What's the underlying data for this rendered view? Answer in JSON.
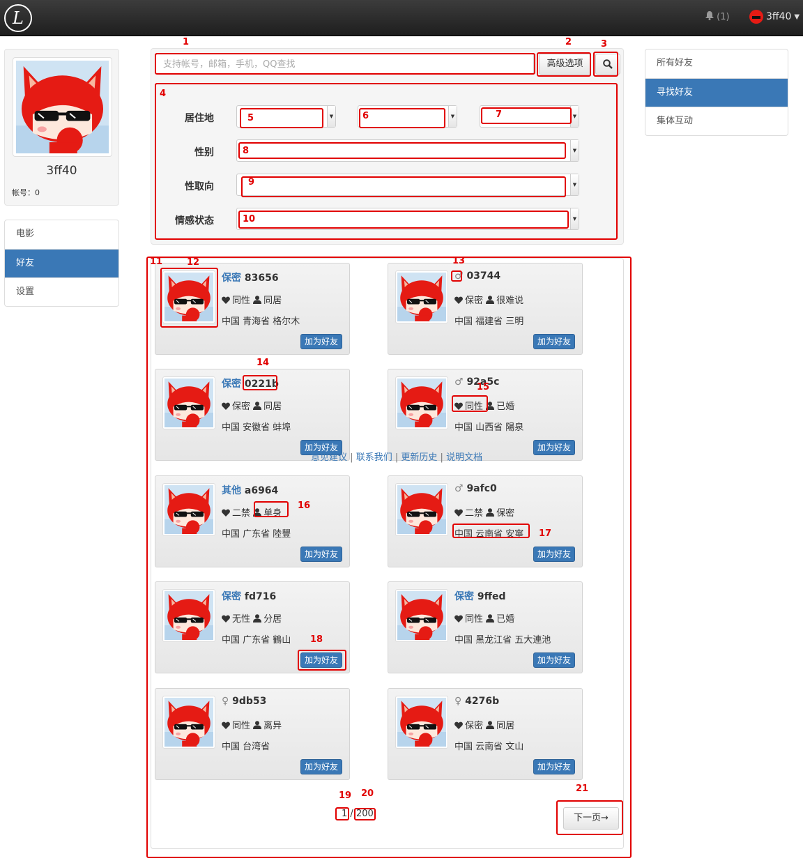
{
  "topbar": {
    "logo_letter": "L",
    "notifications_label": "(1)",
    "username": "3ff40"
  },
  "profile": {
    "name": "3ff40",
    "account_label": "帐号：0"
  },
  "leftnav": {
    "items": [
      {
        "label": "电影",
        "active": false
      },
      {
        "label": "好友",
        "active": true
      },
      {
        "label": "设置",
        "active": false
      }
    ]
  },
  "rightnav": {
    "items": [
      {
        "label": "所有好友",
        "active": false
      },
      {
        "label": "寻找好友",
        "active": true
      },
      {
        "label": "集体互动",
        "active": false
      }
    ]
  },
  "search": {
    "placeholder": "支持帐号，邮箱，手机，QQ查找",
    "advanced_label": "高级选项"
  },
  "filters": {
    "residence_label": "居住地",
    "gender_label": "性别",
    "orientation_label": "性取向",
    "relationship_label": "情感状态"
  },
  "results": [
    {
      "gender": "保密",
      "id": "83656",
      "orientation": "同性",
      "status": "同居",
      "location": "中国 青海省 格尔木"
    },
    {
      "gender": "♂",
      "id": "03744",
      "orientation": "保密",
      "status": "很难说",
      "location": "中国 福建省 三明"
    },
    {
      "gender": "保密",
      "id": "0221b",
      "orientation": "保密",
      "status": "同居",
      "location": "中国 安徽省 蚌埠"
    },
    {
      "gender": "♂",
      "id": "92a5c",
      "orientation": "同性",
      "status": "已婚",
      "location": "中国 山西省 陽泉"
    },
    {
      "gender": "其他",
      "id": "a6964",
      "orientation": "二禁",
      "status": "单身",
      "location": "中国 广东省 陸豐"
    },
    {
      "gender": "♂",
      "id": "9afc0",
      "orientation": "二禁",
      "status": "保密",
      "location": "中国 云南省 安寧"
    },
    {
      "gender": "保密",
      "id": "fd716",
      "orientation": "无性",
      "status": "分居",
      "location": "中国 广东省 鶴山"
    },
    {
      "gender": "保密",
      "id": "9ffed",
      "orientation": "同性",
      "status": "已婚",
      "location": "中国 黑龙江省 五大連池"
    },
    {
      "gender": "♀",
      "id": "9db53",
      "orientation": "同性",
      "status": "离异",
      "location": "中国 台湾省"
    },
    {
      "gender": "♀",
      "id": "4276b",
      "orientation": "保密",
      "status": "同居",
      "location": "中国 云南省 文山"
    }
  ],
  "add_friend_label": "加为好友",
  "footer": {
    "links": [
      "意见建议",
      "联系我们",
      "更新历史",
      "说明文档"
    ],
    "separator": "|"
  },
  "pager": {
    "current": "1",
    "separator": "/",
    "total": "200",
    "next_label": "下一页→"
  },
  "annotations": [
    "1",
    "2",
    "3",
    "4",
    "5",
    "6",
    "7",
    "8",
    "9",
    "10",
    "11",
    "12",
    "13",
    "14",
    "15",
    "16",
    "17",
    "18",
    "19",
    "20",
    "21"
  ],
  "colors": {
    "annotation": "#e10000",
    "accent": "#3a78b6",
    "avatar_red": "#e51b14"
  }
}
